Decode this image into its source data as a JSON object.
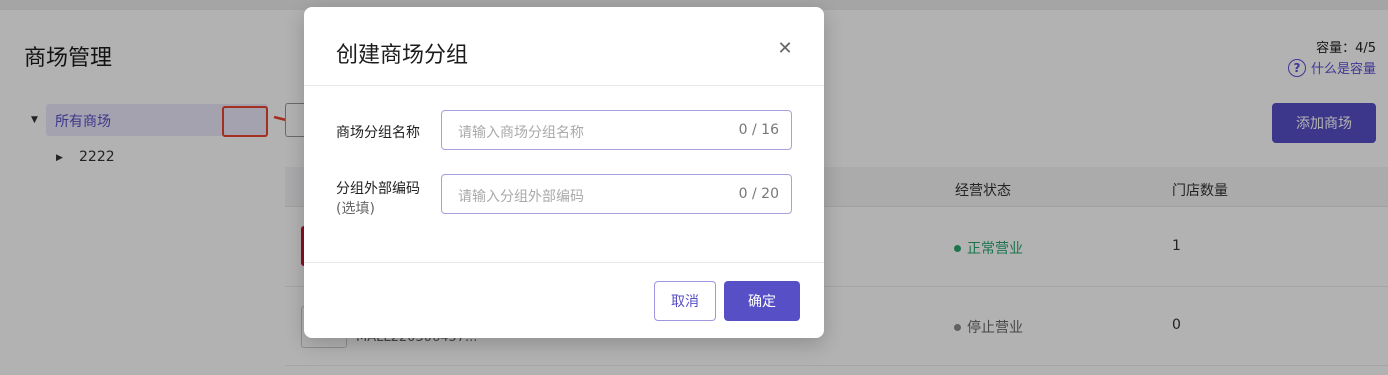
{
  "page": {
    "title": "商场管理",
    "capacity_label": "容量：4/5",
    "capacity_help": "什么是容量",
    "add_button": "添加商场"
  },
  "tree": {
    "root_label": "所有商场",
    "child_label": "2222"
  },
  "table": {
    "headers": [
      "经营状态",
      "门店数量"
    ],
    "rows": [
      {
        "status": "正常营业",
        "status_color": "#2aa873",
        "count": "1"
      },
      {
        "status": "停止营业",
        "status_color": "#8c8c8c",
        "count": "0"
      }
    ],
    "partial_id": "MALL220306457..."
  },
  "modal": {
    "title": "创建商场分组",
    "close_icon": "close-icon",
    "fields": [
      {
        "label": "商场分组名称",
        "sublabel": "",
        "placeholder": "请输入商场分组名称",
        "counter": "0 / 16"
      },
      {
        "label": "分组外部编码",
        "sublabel": "(选填)",
        "placeholder": "请输入分组外部编码",
        "counter": "0 / 20"
      }
    ],
    "cancel": "取消",
    "confirm": "确定"
  },
  "colors": {
    "accent": "#574fc6",
    "annotation": "#e8442e"
  }
}
